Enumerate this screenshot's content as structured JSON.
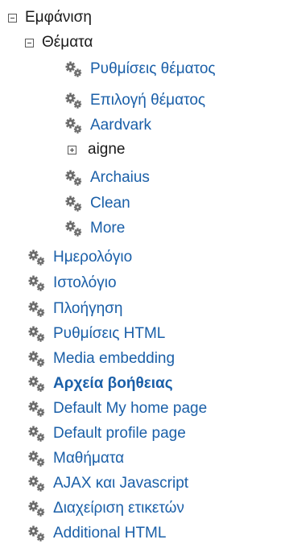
{
  "tree": {
    "root_label": "Εμφάνιση",
    "themes_label": "Θέματα",
    "theme_items": [
      "Ρυθμίσεις θέματος",
      "Επιλογή θέματος",
      "Aardvark",
      "aigne",
      "Archaius",
      "Clean",
      "More"
    ],
    "items": [
      "Ημερολόγιο",
      "Ιστολόγιο",
      "Πλοήγηση",
      "Ρυθμίσεις HTML",
      "Media embedding",
      "Αρχεία βοήθειας",
      "Default My home page",
      "Default profile page",
      "Μαθήματα",
      "AJAX και Javascript",
      "Διαχείριση ετικετών",
      "Additional HTML"
    ]
  },
  "colors": {
    "link": "#1a5fa8",
    "text": "#1a1a1a",
    "gear": "#6b6b6b"
  }
}
